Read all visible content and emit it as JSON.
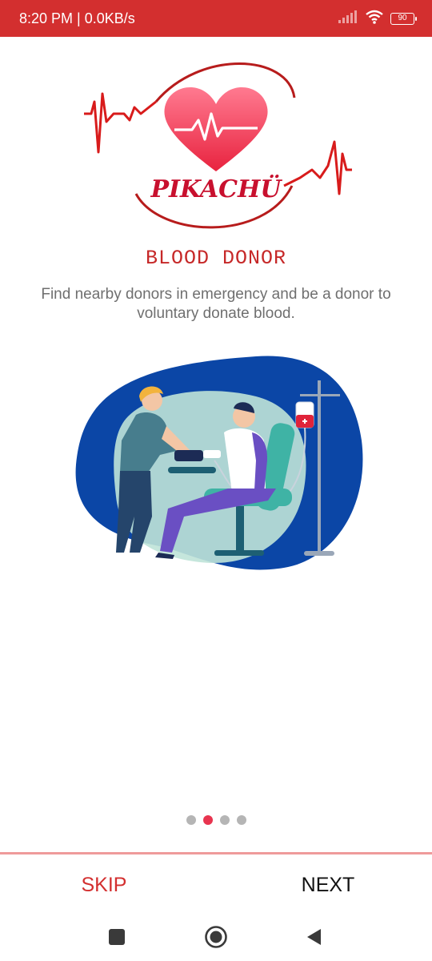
{
  "status_bar": {
    "time_speed": "8:20 PM | 0.0KB/s",
    "battery_level": "90",
    "icons": [
      "signal-icon",
      "wifi-icon",
      "battery-icon"
    ]
  },
  "logo": {
    "brand_text": "PIKACHÜ",
    "colors": {
      "heart": "#ef4b5d",
      "pulse": "#d81b1b"
    }
  },
  "onboarding": {
    "title": "BLOOD DONOR",
    "description": "Find nearby donors in emergency and be a donor to voluntary donate blood.",
    "illustration": "blood-donation-illustration",
    "page_indicator": {
      "total": 4,
      "current": 2
    }
  },
  "footer": {
    "skip_label": "SKIP",
    "next_label": "NEXT"
  },
  "nav_bar": {
    "icons": [
      "recent-apps-icon",
      "home-icon",
      "back-icon"
    ]
  },
  "colors": {
    "accent": "#d32f2f",
    "active_dot": "#e8344f",
    "inactive_dot": "#b5b5b5",
    "divider": "#ef9a9a"
  }
}
